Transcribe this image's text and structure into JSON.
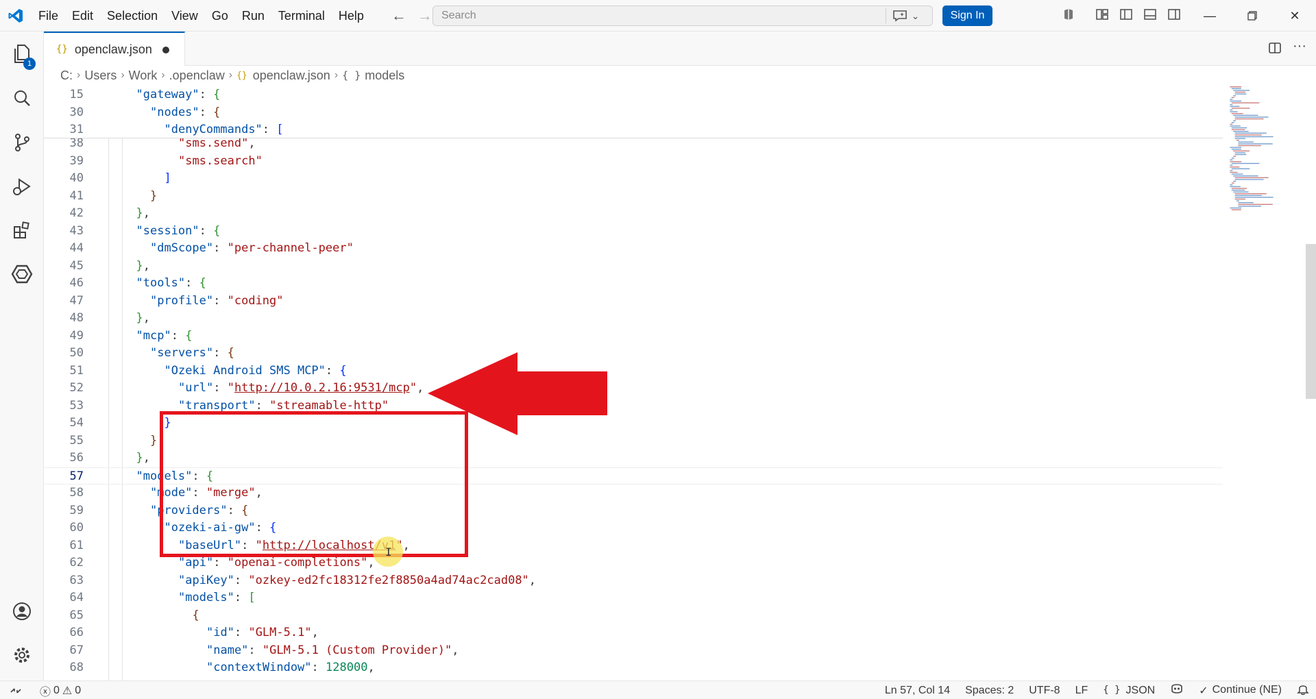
{
  "titlebar": {
    "menu": [
      "File",
      "Edit",
      "Selection",
      "View",
      "Go",
      "Run",
      "Terminal",
      "Help"
    ],
    "search_placeholder": "Search",
    "signin_label": "Sign In"
  },
  "activitybar": {
    "explorer_badge": "1"
  },
  "tab": {
    "label": "openclaw.json",
    "icon": "{}"
  },
  "breadcrumb": {
    "items": [
      "C:",
      "Users",
      "Work",
      ".openclaw",
      "openclaw.json",
      "models"
    ],
    "json_icon": "{}",
    "object_icon": "{ }"
  },
  "editor": {
    "sticky_lines": [
      {
        "n": "15",
        "t": "  \"gateway\": {"
      },
      {
        "n": "30",
        "t": "    \"nodes\": {"
      },
      {
        "n": "31",
        "t": "      \"denyCommands\": ["
      }
    ],
    "lines": [
      {
        "n": "38",
        "t": "        \"sms.send\","
      },
      {
        "n": "39",
        "t": "        \"sms.search\""
      },
      {
        "n": "40",
        "t": "      ]"
      },
      {
        "n": "41",
        "t": "    }"
      },
      {
        "n": "42",
        "t": "  },"
      },
      {
        "n": "43",
        "t": "  \"session\": {"
      },
      {
        "n": "44",
        "t": "    \"dmScope\": \"per-channel-peer\""
      },
      {
        "n": "45",
        "t": "  },"
      },
      {
        "n": "46",
        "t": "  \"tools\": {"
      },
      {
        "n": "47",
        "t": "    \"profile\": \"coding\""
      },
      {
        "n": "48",
        "t": "  },"
      },
      {
        "n": "49",
        "t": "  \"mcp\": {"
      },
      {
        "n": "50",
        "t": "    \"servers\": {"
      },
      {
        "n": "51",
        "t": "      \"Ozeki Android SMS MCP\": {"
      },
      {
        "n": "52",
        "t": "        \"url\": \"http://10.0.2.16:9531/mcp\","
      },
      {
        "n": "53",
        "t": "        \"transport\": \"streamable-http\""
      },
      {
        "n": "54",
        "t": "      }"
      },
      {
        "n": "55",
        "t": "    }"
      },
      {
        "n": "56",
        "t": "  },"
      },
      {
        "n": "57",
        "t": "  \"models\": {"
      },
      {
        "n": "58",
        "t": "    \"mode\": \"merge\","
      },
      {
        "n": "59",
        "t": "    \"providers\": {"
      },
      {
        "n": "60",
        "t": "      \"ozeki-ai-gw\": {"
      },
      {
        "n": "61",
        "t": "        \"baseUrl\": \"http://localhost/v1\","
      },
      {
        "n": "62",
        "t": "        \"api\": \"openai-completions\","
      },
      {
        "n": "63",
        "t": "        \"apiKey\": \"ozkey-ed2fc18312fe2f8850a4ad74ac2cad08\","
      },
      {
        "n": "64",
        "t": "        \"models\": ["
      },
      {
        "n": "65",
        "t": "          {"
      },
      {
        "n": "66",
        "t": "            \"id\": \"GLM-5.1\","
      },
      {
        "n": "67",
        "t": "            \"name\": \"GLM-5.1 (Custom Provider)\","
      },
      {
        "n": "68",
        "t": "            \"contextWindow\": 128000,"
      }
    ],
    "current_line": "57"
  },
  "statusbar": {
    "errors": "0",
    "warnings": "0",
    "position": "Ln 57, Col 14",
    "spaces": "Spaces: 2",
    "encoding": "UTF-8",
    "eol": "LF",
    "language": "JSON",
    "language_icon": "{ }",
    "continue_label": "Continue (NE)"
  },
  "colors": {
    "accent": "#005fb8",
    "highlight_red": "#e4141d",
    "json_key": "#0451a5",
    "json_string": "#a31515",
    "json_number": "#098658"
  }
}
